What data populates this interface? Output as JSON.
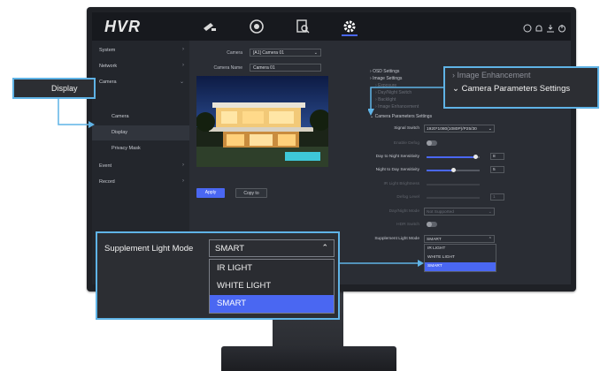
{
  "app": {
    "logo": "HVR"
  },
  "nav": {
    "icons": [
      "camera-icon",
      "playback-icon",
      "search-icon",
      "settings-icon"
    ],
    "active": "settings-icon"
  },
  "tray_icons": [
    "info-icon",
    "alarm-icon",
    "download-icon",
    "power-icon"
  ],
  "sidebar": {
    "items": [
      {
        "label": "System",
        "chevron": "›"
      },
      {
        "label": "Network",
        "chevron": "›"
      },
      {
        "label": "Camera",
        "chevron": "⌄"
      },
      {
        "label": "Camera",
        "chevron": ""
      },
      {
        "label": "Display",
        "chevron": ""
      },
      {
        "label": "Privacy Mask",
        "chevron": ""
      },
      {
        "label": "Event",
        "chevron": "›"
      },
      {
        "label": "Record",
        "chevron": "›"
      }
    ],
    "active_index": 4
  },
  "form": {
    "camera_label": "Camera",
    "camera_value": "[A1] Camera 01",
    "camera_name_label": "Camera Name",
    "camera_name_value": "Camera 01"
  },
  "buttons": {
    "apply": "Apply",
    "copy": "Copy to"
  },
  "settings_menu": {
    "items": [
      {
        "label": "OSD Settings",
        "dim": false
      },
      {
        "label": "Image Settings",
        "dim": false
      },
      {
        "label": "Exposure",
        "dim": true
      },
      {
        "label": "Day/Night Switch",
        "dim": true
      },
      {
        "label": "Backlight",
        "dim": true
      },
      {
        "label": "Image Enhancement",
        "dim": true
      },
      {
        "label": "Camera Parameters Settings",
        "dim": false
      }
    ]
  },
  "params": {
    "signal_switch_label": "Signal Switch",
    "signal_switch_value": "1920*1080(1080P)/P25/30",
    "enable_defog_label": "Enable Defog",
    "day_to_night_label": "Day to Night Sensitivity",
    "day_to_night_value": "8",
    "night_to_day_label": "Night to Day Sensitivity",
    "night_to_day_value": "5",
    "ir_light_label": "IR Light Brightness",
    "defog_level_label": "Defog Level",
    "defog_level_value": "1",
    "day_night_mode_label": "Day/Night Mode",
    "day_night_mode_value": "Not Supported",
    "hdr_label": "HDR Switch",
    "supplement_label": "Supplement Light Mode",
    "supplement_value": "SMART",
    "options": [
      "IR LIGHT",
      "WHITE LIGHT",
      "SMART"
    ],
    "selected_index": 2
  },
  "callouts": {
    "display": "Display",
    "image_enhancement": "Image Enhancement",
    "camera_params": "Camera Parameters Settings",
    "supplement_label": "Supplement Light Mode",
    "supplement_value": "SMART",
    "options": [
      "IR LIGHT",
      "WHITE LIGHT",
      "SMART"
    ]
  },
  "colors": {
    "accent": "#4a67f2",
    "callout_border": "#5fb3e6",
    "callout_bg": "#2c2e33"
  }
}
